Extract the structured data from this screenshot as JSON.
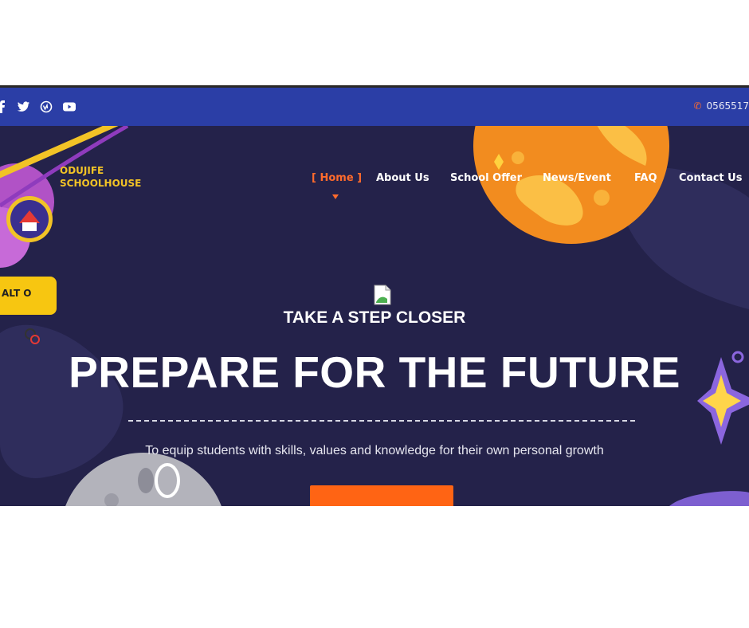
{
  "topbar": {
    "social_icons": [
      "facebook-icon",
      "twitter-icon",
      "vimeo-icon",
      "youtube-icon"
    ],
    "phone": "0565517"
  },
  "logo": {
    "line1": "ODUJIFE",
    "line2": "SCHOOLHOUSE"
  },
  "nav": {
    "items": [
      "[ Home ]",
      "About Us",
      "School Offer",
      "News/Event",
      "FAQ",
      "Contact Us"
    ],
    "active_index": 0
  },
  "badge": {
    "text": "ALT O"
  },
  "hero": {
    "eyebrow": "TAKE A STEP CLOSER",
    "headline": "PREPARE FOR THE FUTURE",
    "tagline": "To equip students with skills, values and knowledge for their own personal growth"
  },
  "colors": {
    "topbar": "#2b3ea6",
    "hero_bg": "#24224a",
    "accent": "#ff6b2c",
    "badge": "#f7c611",
    "cta": "#ff6414"
  }
}
